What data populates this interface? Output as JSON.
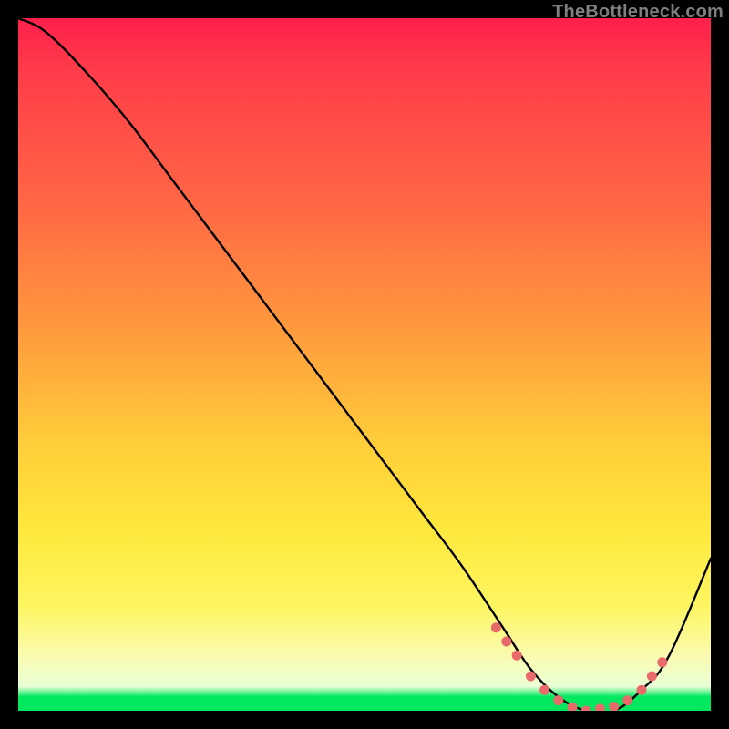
{
  "watermark": "TheBottleneck.com",
  "chart_data": {
    "type": "line",
    "title": "",
    "xlabel": "",
    "ylabel": "",
    "xlim": [
      0,
      100
    ],
    "ylim": [
      0,
      100
    ],
    "series": [
      {
        "name": "bottleneck-curve",
        "x": [
          0,
          4,
          10,
          16,
          22,
          28,
          34,
          40,
          46,
          52,
          58,
          64,
          70,
          74,
          78,
          82,
          86,
          90,
          94,
          100
        ],
        "y": [
          100,
          98,
          92,
          85,
          77,
          69,
          61,
          53,
          45,
          37,
          29,
          21,
          12,
          6,
          2,
          0,
          0,
          3,
          8,
          22
        ]
      }
    ],
    "markers": {
      "name": "highlight-dots",
      "color": "#e96a6a",
      "x": [
        69,
        70.5,
        72,
        74,
        76,
        78,
        80,
        82,
        84,
        86,
        88,
        90,
        91.5,
        93
      ],
      "y": [
        12,
        10,
        8,
        5,
        3,
        1.5,
        0.5,
        0,
        0.3,
        0.6,
        1.5,
        3,
        5,
        7
      ]
    }
  }
}
